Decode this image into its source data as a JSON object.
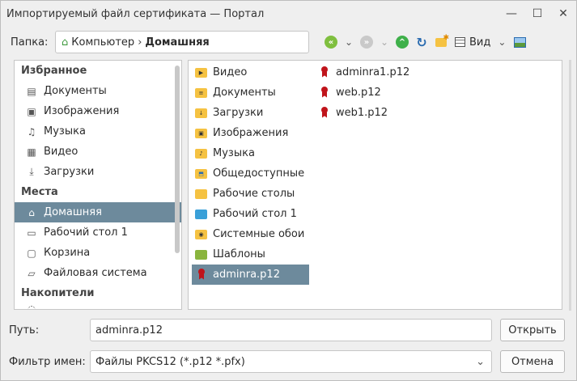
{
  "window": {
    "title": "Импортируемый файл сертификата — Портал"
  },
  "toolbar": {
    "folder_label": "Папка:",
    "path": [
      "Компьютер",
      "Домашняя"
    ],
    "view_label": "Вид"
  },
  "sidebar": {
    "sections": [
      {
        "title": "Избранное",
        "items": [
          {
            "label": "Документы",
            "icon": "document-icon"
          },
          {
            "label": "Изображения",
            "icon": "image-icon"
          },
          {
            "label": "Музыка",
            "icon": "music-icon"
          },
          {
            "label": "Видео",
            "icon": "video-icon"
          },
          {
            "label": "Загрузки",
            "icon": "download-icon"
          }
        ]
      },
      {
        "title": "Места",
        "items": [
          {
            "label": "Домашняя",
            "icon": "home-icon",
            "active": true
          },
          {
            "label": "Рабочий стол 1",
            "icon": "desktop-icon"
          },
          {
            "label": "Корзина",
            "icon": "trash-icon"
          },
          {
            "label": "Файловая система",
            "icon": "filesystem-icon"
          }
        ]
      },
      {
        "title": "Накопители",
        "items": []
      }
    ]
  },
  "files": {
    "column1": [
      {
        "name": "Видео",
        "type": "folder",
        "badge": "▶"
      },
      {
        "name": "Документы",
        "type": "folder",
        "badge": "≡"
      },
      {
        "name": "Загрузки",
        "type": "folder",
        "badge": "↓"
      },
      {
        "name": "Изображения",
        "type": "folder",
        "badge": "▣"
      },
      {
        "name": "Музыка",
        "type": "folder",
        "badge": "♪"
      },
      {
        "name": "Общедоступные",
        "type": "folder",
        "badge": "⬒"
      },
      {
        "name": "Рабочие столы",
        "type": "folder",
        "badge": ""
      },
      {
        "name": "Рабочий стол 1",
        "type": "folder-blue",
        "badge": ""
      },
      {
        "name": "Системные обои",
        "type": "folder",
        "badge": "◉"
      },
      {
        "name": "Шаблоны",
        "type": "folder-green",
        "badge": ""
      },
      {
        "name": "adminra.p12",
        "type": "cert",
        "selected": true
      }
    ],
    "column2": [
      {
        "name": "adminra1.p12",
        "type": "cert"
      },
      {
        "name": "web.p12",
        "type": "cert"
      },
      {
        "name": "web1.p12",
        "type": "cert"
      }
    ]
  },
  "bottom": {
    "path_label": "Путь:",
    "path_value": "adminra.p12",
    "open_button": "Открыть",
    "filter_label": "Фильтр имен:",
    "filter_value": "Файлы PKCS12 (*.p12 *.pfx)",
    "cancel_button": "Отмена"
  },
  "colors": {
    "selection": "#6d8a9c",
    "folder": "#f5c242",
    "cert": "#c0141b",
    "back": "#7fbf3f",
    "up": "#3fb04a"
  }
}
